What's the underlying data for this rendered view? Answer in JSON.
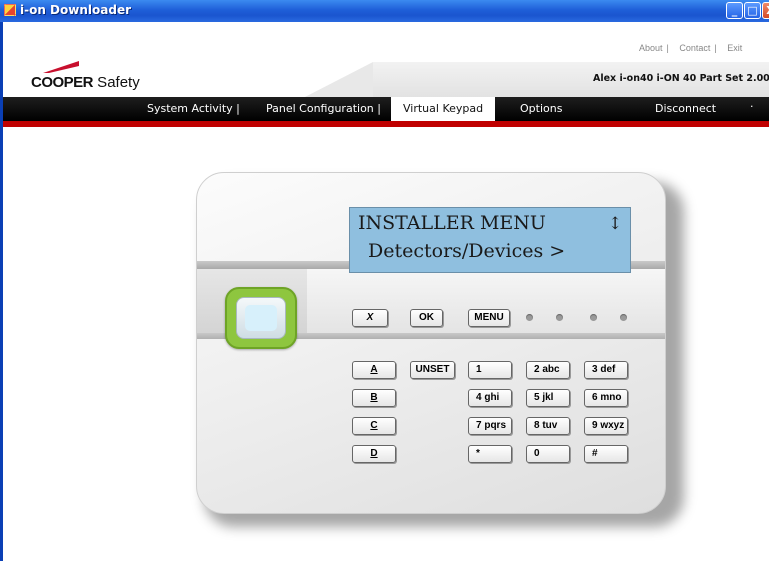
{
  "window": {
    "title": "i-on Downloader",
    "controls": {
      "minimize": "_",
      "maximize": "□",
      "close": "X"
    }
  },
  "header": {
    "links": [
      "About",
      "Contact",
      "Exit"
    ],
    "logo": {
      "brand_bold": "COOPER",
      "brand_rest": " Safety"
    },
    "panel_info": "Alex i-on40 i-ON 40 Part Set 2.00"
  },
  "nav": {
    "items": [
      "System Activity |",
      "Panel Configuration |",
      "Virtual Keypad",
      "Options",
      "Disconnect",
      "·"
    ],
    "active": "Virtual Keypad"
  },
  "keypad": {
    "lcd": {
      "line1": "INSTALLER MENU",
      "line2": "Detectors/Devices >",
      "scroll_glyph": "↕"
    },
    "function_keys": {
      "cancel": "X",
      "ok": "OK",
      "menu": "MENU"
    },
    "side_keys": [
      "A",
      "B",
      "C",
      "D"
    ],
    "unset": "UNSET",
    "number_keys": [
      [
        "1",
        "2 abc",
        "3 def"
      ],
      [
        "4 ghi",
        "5 jkl",
        "6 mno"
      ],
      [
        "7 pqrs",
        "8 tuv",
        "9 wxyz"
      ],
      [
        "*",
        "0",
        "#"
      ]
    ]
  }
}
